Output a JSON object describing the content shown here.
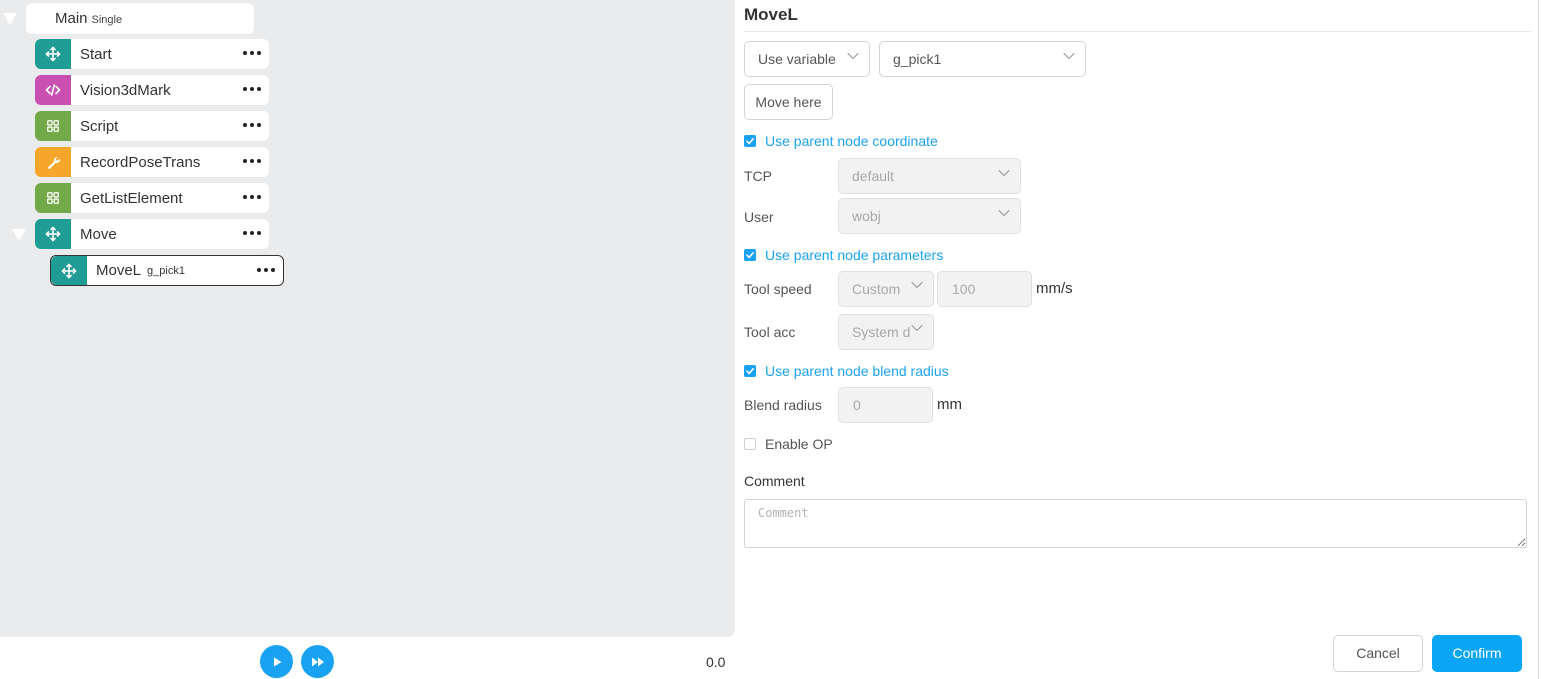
{
  "tree": {
    "root": {
      "label": "Main",
      "sub": "Single"
    },
    "nodes": [
      {
        "label": "Start",
        "icon": "move-arrows-icon",
        "color": "#1f9c94"
      },
      {
        "label": "Vision3dMark",
        "icon": "code-icon",
        "color": "#c94fb0"
      },
      {
        "label": "Script",
        "icon": "grid-icon",
        "color": "#73a948"
      },
      {
        "label": "RecordPoseTrans",
        "icon": "wrench-icon",
        "color": "#f6a62b"
      },
      {
        "label": "GetListElement",
        "icon": "grid-icon",
        "color": "#73a948"
      },
      {
        "label": "Move",
        "icon": "move-arrows-icon",
        "color": "#1f9c94"
      }
    ],
    "child": {
      "label": "MoveL",
      "sub": "g_pick1",
      "icon": "move-arrows-icon",
      "color": "#1f9c94"
    }
  },
  "playback": {
    "time": "0.0"
  },
  "form": {
    "title": "MoveL",
    "source_select": "Use variable",
    "variable_select": "g_pick1",
    "move_here_label": "Move here",
    "use_parent_coordinate": {
      "label": "Use parent node coordinate",
      "checked": true
    },
    "tcp": {
      "label": "TCP",
      "value": "default"
    },
    "user": {
      "label": "User",
      "value": "wobj"
    },
    "use_parent_parameters": {
      "label": "Use parent node parameters",
      "checked": true
    },
    "tool_speed": {
      "label": "Tool speed",
      "mode": "Custom",
      "value": "100",
      "unit": "mm/s"
    },
    "tool_acc": {
      "label": "Tool acc",
      "mode": "System d"
    },
    "use_parent_blend": {
      "label": "Use parent node blend radius",
      "checked": true
    },
    "blend_radius": {
      "label": "Blend radius",
      "placeholder": "0",
      "unit": "mm"
    },
    "enable_op": {
      "label": "Enable OP",
      "checked": false
    },
    "comment": {
      "label": "Comment",
      "placeholder": "Comment"
    },
    "cancel_label": "Cancel",
    "confirm_label": "Confirm"
  },
  "colors": {
    "accent": "#1aa2f2",
    "confirm": "#0aa6f5",
    "panel": "#eaebec"
  }
}
